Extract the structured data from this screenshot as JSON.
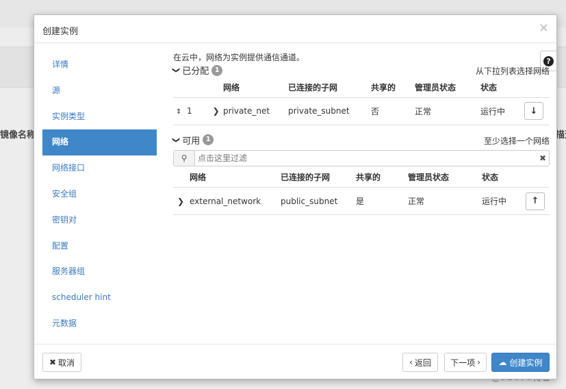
{
  "background": {
    "left_label": "镜像名称",
    "right_label": "描述",
    "watermark": "@51CTO博客"
  },
  "modal": {
    "title": "创建实例",
    "close_icon": "×"
  },
  "sidebar": {
    "items": [
      {
        "label": "详情"
      },
      {
        "label": "源"
      },
      {
        "label": "实例类型"
      },
      {
        "label": "网络"
      },
      {
        "label": "网络接口"
      },
      {
        "label": "安全组"
      },
      {
        "label": "密钥对"
      },
      {
        "label": "配置"
      },
      {
        "label": "服务器组"
      },
      {
        "label": "scheduler hint"
      },
      {
        "label": "元数据"
      }
    ],
    "active_index": 3
  },
  "help": {
    "icon": "?"
  },
  "main": {
    "intro": "在云中，网络为实例提供通信通道。",
    "allocated": {
      "title": "已分配",
      "count": "1",
      "hint": "从下拉列表选择网络",
      "columns": [
        "网络",
        "已连接的子网",
        "共享的",
        "管理员状态",
        "状态"
      ],
      "rows": [
        {
          "order": "1",
          "network": "private_net",
          "subnet": "private_subnet",
          "shared": "否",
          "admin_state": "正常",
          "status": "运行中"
        }
      ]
    },
    "available": {
      "title": "可用",
      "count": "1",
      "hint": "至少选择一个网络",
      "filter_placeholder": "点击这里过滤",
      "columns": [
        "网络",
        "已连接的子网",
        "共享的",
        "管理员状态",
        "状态"
      ],
      "rows": [
        {
          "network": "external_network",
          "subnet": "public_subnet",
          "shared": "是",
          "admin_state": "正常",
          "status": "运行中"
        }
      ]
    }
  },
  "footer": {
    "cancel": "取消",
    "back": "返回",
    "next": "下一项",
    "create": "创建实例"
  }
}
